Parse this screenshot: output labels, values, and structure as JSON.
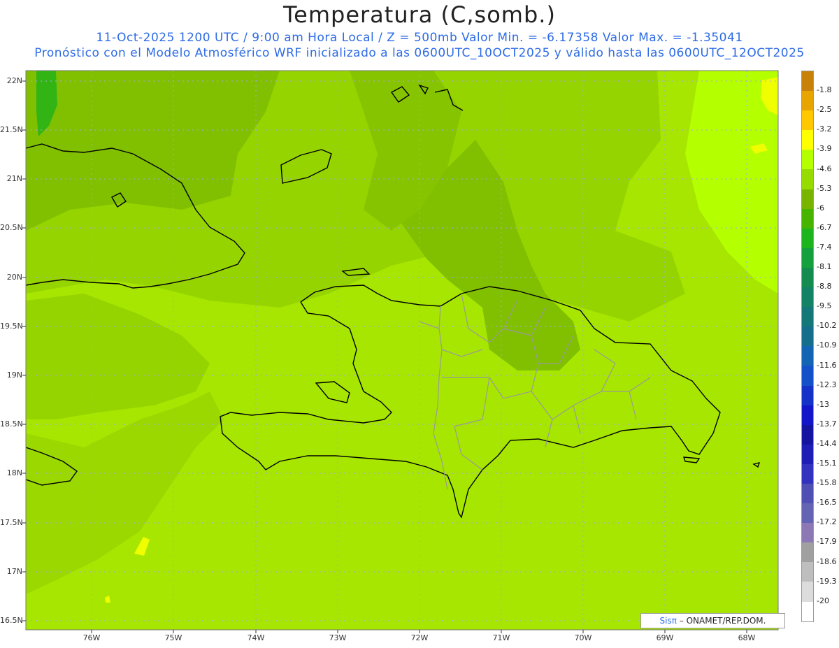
{
  "header": {
    "title": "Temperatura (C,somb.)",
    "line1": "11-Oct-2025  1200 UTC / 9:00 am Hora Local / Z = 500mb  Valor Min. = -6.17358  Valor Max. = -1.35041",
    "line2": "Pronóstico con el Modelo Atmosférico WRF inicializado a las 0600UTC_10OCT2025 y válido hasta las  0600UTC_12OCT2025"
  },
  "axes": {
    "lat_labels": [
      "22N",
      "21.5N",
      "21N",
      "20.5N",
      "20N",
      "19.5N",
      "19N",
      "18.5N",
      "18N",
      "17.5N",
      "17N",
      "16.5N"
    ],
    "lon_labels": [
      "76W",
      "75W",
      "74W",
      "73W",
      "72W",
      "71W",
      "70W",
      "69W",
      "68W"
    ]
  },
  "legend": {
    "values": [
      "-1.8",
      "-2.5",
      "-3.2",
      "-3.9",
      "-4.6",
      "-5.3",
      "-6",
      "-6.7",
      "-7.4",
      "-8.1",
      "-8.8",
      "-9.5",
      "-10.2",
      "-10.9",
      "-11.6",
      "-12.3",
      "-13",
      "-13.7",
      "-14.4",
      "-15.1",
      "-15.8",
      "-16.5",
      "-17.2",
      "-17.9",
      "-18.6",
      "-19.3",
      "-20"
    ],
    "colors": [
      "#c8820a",
      "#e8a400",
      "#ffc800",
      "#ffff00",
      "#b4ff00",
      "#96dc00",
      "#78b400",
      "#46b400",
      "#1eb41e",
      "#14a03c",
      "#148c50",
      "#148264",
      "#147878",
      "#146e8c",
      "#1464b4",
      "#1450c8",
      "#1432c8",
      "#1414c8",
      "#1414a0",
      "#1e1eb4",
      "#3232be",
      "#5050b4",
      "#6464b4",
      "#8c78b4",
      "#a0a0a0",
      "#bebebe",
      "#dcdcdc",
      "#ffffff"
    ]
  },
  "credit": {
    "brand": "Sisπ",
    "text": "– ONAMET/REP.DOM."
  }
}
